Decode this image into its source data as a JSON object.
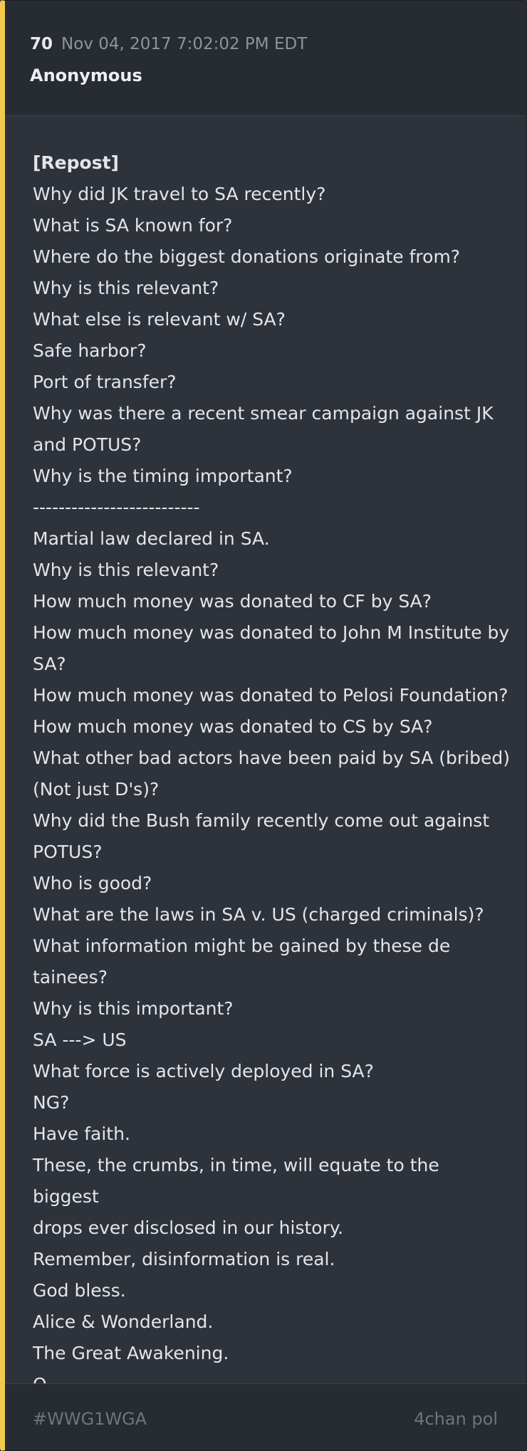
{
  "post": {
    "number": "70",
    "timestamp": "Nov 04, 2017 7:02:02 PM EDT",
    "author": "Anonymous",
    "lines": [
      "[Repost]",
      "Why did JK travel to SA recently?",
      "What is SA known for?",
      "Where do the biggest donations originate from?",
      "Why is this relevant?",
      "What else is relevant w/ SA?",
      "Safe harbor?",
      "Port of transfer?",
      "Why was there a recent smear campaign against JK",
      "and POTUS?",
      "Why is the timing important?",
      "--------------------------",
      "Martial law declared in SA.",
      "Why is this relevant?",
      "How much money was donated to CF by SA?",
      "How much money was donated to John M Institute by",
      "SA?",
      "How much money was donated to Pelosi Foundation?",
      "How much money was donated to CS by SA?",
      "What other bad actors have been paid by SA (bribed)",
      "(Not just D's)?",
      "Why did the Bush family recently come out against",
      "POTUS?",
      "Who is good?",
      "What are the laws in SA v. US (charged criminals)?",
      "What information might be gained by these de",
      "tainees?",
      "Why is this important?",
      "SA ---> US",
      "What force is actively deployed in SA?",
      "NG?",
      "Have faith.",
      "These, the crumbs, in time, will equate to the biggest",
      "drops ever disclosed in our history.",
      "Remember, disinformation is real.",
      "God bless.",
      "Alice & Wonderland.",
      "The Great Awakening.",
      "Q"
    ]
  },
  "footer": {
    "tag": "#WWG1WGA",
    "board": "4chan pol"
  },
  "colors": {
    "accent": "#f2c94c",
    "background": "#2e333b",
    "header_background": "#272b32",
    "text": "#e3e5e8",
    "muted": "#8e949c"
  }
}
